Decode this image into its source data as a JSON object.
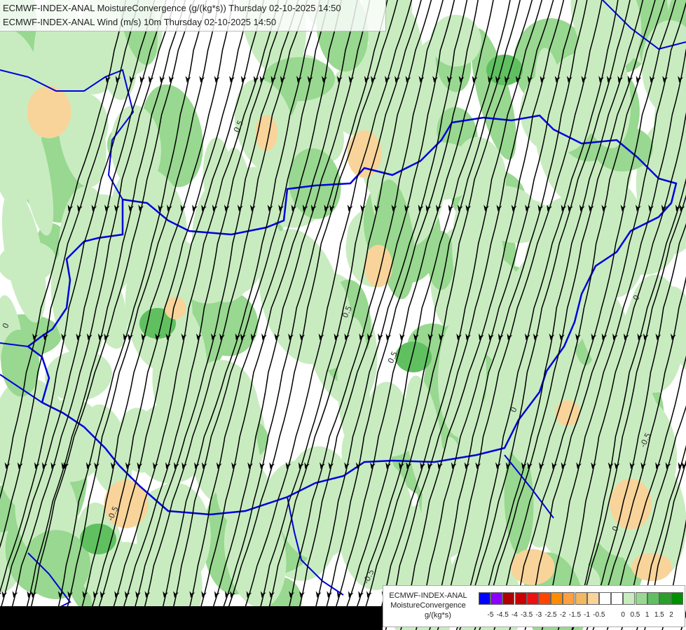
{
  "header": {
    "line1": "ECMWF-INDEX-ANAL MoistureConvergence (g/(kg*s)) Thursday 02-10-2025 14:50",
    "line2": "ECMWF-INDEX-ANAL Wind (m/s) 10m Thursday 02-10-2025 14:50"
  },
  "legend": {
    "title_line1": "ECMWF-INDEX-ANAL",
    "title_line2": "MoistureConvergence",
    "title_line3": "g/(kg*s)",
    "colors": [
      "#0000ff",
      "#8b00ff",
      "#b00000",
      "#cc0000",
      "#ee1010",
      "#ff4500",
      "#ff8c00",
      "#ffa040",
      "#f4b860",
      "#f8d49a",
      "#ffffff",
      "#ffffff",
      "#c8ecc0",
      "#98d890",
      "#60c060",
      "#2aa02a",
      "#009000"
    ],
    "labels": [
      "-5",
      "-4.5",
      "-4",
      "-3.5",
      "-3",
      "-2.5",
      "-2",
      "-1.5",
      "-1",
      "-0.5",
      "0",
      "0.5",
      "1",
      "1.5",
      "2"
    ]
  },
  "map_labels": [
    "0.5",
    "0",
    "-0.5",
    "0",
    "0.5",
    "-0.5",
    "0",
    "0.5",
    "0",
    "-0.5"
  ]
}
